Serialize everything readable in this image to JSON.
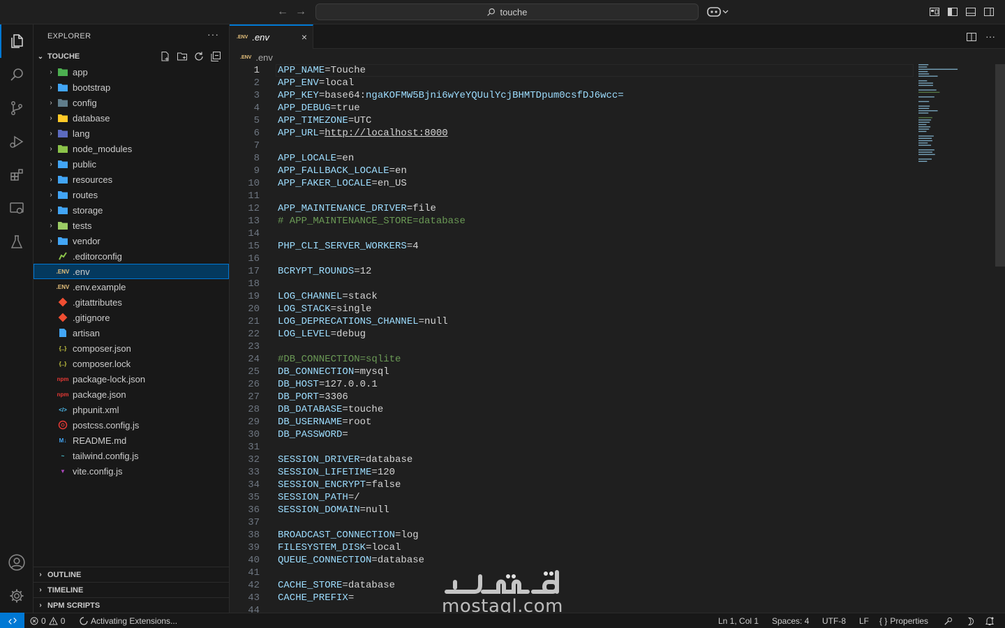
{
  "titlebar": {
    "search_text": "touche"
  },
  "sidebar": {
    "title": "EXPLORER",
    "more": "···",
    "folder_name": "TOUCHE",
    "items": [
      {
        "label": "app",
        "kind": "folder",
        "icon": "app-folder-icon",
        "color": "#4caf50"
      },
      {
        "label": "bootstrap",
        "kind": "folder",
        "icon": "folder-icon",
        "color": "#42a5f5"
      },
      {
        "label": "config",
        "kind": "folder",
        "icon": "config-folder-icon",
        "color": "#607d8b"
      },
      {
        "label": "database",
        "kind": "folder",
        "icon": "database-folder-icon",
        "color": "#ffca28"
      },
      {
        "label": "lang",
        "kind": "folder",
        "icon": "lang-folder-icon",
        "color": "#5c6bc0"
      },
      {
        "label": "node_modules",
        "kind": "folder",
        "icon": "node-folder-icon",
        "color": "#8bc34a"
      },
      {
        "label": "public",
        "kind": "folder",
        "icon": "folder-icon",
        "color": "#42a5f5"
      },
      {
        "label": "resources",
        "kind": "folder",
        "icon": "folder-icon",
        "color": "#42a5f5"
      },
      {
        "label": "routes",
        "kind": "folder",
        "icon": "folder-icon",
        "color": "#42a5f5"
      },
      {
        "label": "storage",
        "kind": "folder",
        "icon": "folder-icon",
        "color": "#42a5f5"
      },
      {
        "label": "tests",
        "kind": "folder",
        "icon": "tests-folder-icon",
        "color": "#9ccc65"
      },
      {
        "label": "vendor",
        "kind": "folder",
        "icon": "folder-icon",
        "color": "#42a5f5"
      },
      {
        "label": ".editorconfig",
        "kind": "file",
        "icon": "editorconfig-icon",
        "color": "#8bc34a"
      },
      {
        "label": ".env",
        "kind": "file",
        "icon": "env-file-icon",
        "color": "#e5c07b",
        "badge": ".ENV"
      },
      {
        "label": ".env.example",
        "kind": "file",
        "icon": "env-file-icon",
        "color": "#e5c07b",
        "badge": ".ENV"
      },
      {
        "label": ".gitattributes",
        "kind": "file",
        "icon": "git-icon",
        "color": "#f14e32"
      },
      {
        "label": ".gitignore",
        "kind": "file",
        "icon": "git-icon",
        "color": "#f14e32"
      },
      {
        "label": "artisan",
        "kind": "file",
        "icon": "file-icon",
        "color": "#42a5f5"
      },
      {
        "label": "composer.json",
        "kind": "file",
        "icon": "json-braces-icon",
        "color": "#cbcb41",
        "badge": "{..}"
      },
      {
        "label": "composer.lock",
        "kind": "file",
        "icon": "json-braces-icon",
        "color": "#cbcb41",
        "badge": "{..}"
      },
      {
        "label": "package-lock.json",
        "kind": "file",
        "icon": "npm-icon",
        "color": "#e53935",
        "badge": "npm"
      },
      {
        "label": "package.json",
        "kind": "file",
        "icon": "npm-icon",
        "color": "#e53935",
        "badge": "npm"
      },
      {
        "label": "phpunit.xml",
        "kind": "file",
        "icon": "xml-icon",
        "color": "#4fc3f7",
        "badge": "</>"
      },
      {
        "label": "postcss.config.js",
        "kind": "file",
        "icon": "postcss-icon",
        "color": "#e53935"
      },
      {
        "label": "README.md",
        "kind": "file",
        "icon": "markdown-icon",
        "color": "#42a5f5",
        "badge": "M↓"
      },
      {
        "label": "tailwind.config.js",
        "kind": "file",
        "icon": "tailwind-icon",
        "color": "#4dd0e1",
        "badge": "~"
      },
      {
        "label": "vite.config.js",
        "kind": "file",
        "icon": "vite-icon",
        "color": "#ab47bc",
        "badge": "▼"
      }
    ],
    "selected_index": 13,
    "bottom_sections": [
      "OUTLINE",
      "TIMELINE",
      "NPM SCRIPTS"
    ]
  },
  "editor": {
    "tab_label": ".env",
    "tab_badge": ".ENV",
    "tab_close": "×",
    "breadcrumb": ".env",
    "lines": [
      {
        "n": "1",
        "k": "APP_NAME",
        "v": "Touche"
      },
      {
        "n": "2",
        "k": "APP_ENV",
        "v": "local"
      },
      {
        "n": "3",
        "k": "APP_KEY",
        "v": "base64:",
        "v2": "ngaKOFMW5Bjni6wYeYQUulYcjBHMTDpum0csfDJ6wcc="
      },
      {
        "n": "4",
        "k": "APP_DEBUG",
        "v": "true"
      },
      {
        "n": "5",
        "k": "APP_TIMEZONE",
        "v": "UTC"
      },
      {
        "n": "6",
        "k": "APP_URL",
        "v": "http://localhost:8000",
        "url": true
      },
      {
        "n": "7"
      },
      {
        "n": "8",
        "k": "APP_LOCALE",
        "v": "en"
      },
      {
        "n": "9",
        "k": "APP_FALLBACK_LOCALE",
        "v": "en"
      },
      {
        "n": "10",
        "k": "APP_FAKER_LOCALE",
        "v": "en_US"
      },
      {
        "n": "11"
      },
      {
        "n": "12",
        "k": "APP_MAINTENANCE_DRIVER",
        "v": "file"
      },
      {
        "n": "13",
        "c": "# APP_MAINTENANCE_STORE=database"
      },
      {
        "n": "14"
      },
      {
        "n": "15",
        "k": "PHP_CLI_SERVER_WORKERS",
        "v": "4"
      },
      {
        "n": "16"
      },
      {
        "n": "17",
        "k": "BCRYPT_ROUNDS",
        "v": "12"
      },
      {
        "n": "18"
      },
      {
        "n": "19",
        "k": "LOG_CHANNEL",
        "v": "stack"
      },
      {
        "n": "20",
        "k": "LOG_STACK",
        "v": "single"
      },
      {
        "n": "21",
        "k": "LOG_DEPRECATIONS_CHANNEL",
        "v": "null"
      },
      {
        "n": "22",
        "k": "LOG_LEVEL",
        "v": "debug"
      },
      {
        "n": "23"
      },
      {
        "n": "24",
        "c": "#DB_CONNECTION=sqlite"
      },
      {
        "n": "25",
        "k": "DB_CONNECTION",
        "v": "mysql"
      },
      {
        "n": "26",
        "k": "DB_HOST",
        "v": "127.0.0.1"
      },
      {
        "n": "27",
        "k": "DB_PORT",
        "v": "3306"
      },
      {
        "n": "28",
        "k": "DB_DATABASE",
        "v": "touche"
      },
      {
        "n": "29",
        "k": "DB_USERNAME",
        "v": "root"
      },
      {
        "n": "30",
        "k": "DB_PASSWORD",
        "v": ""
      },
      {
        "n": "31"
      },
      {
        "n": "32",
        "k": "SESSION_DRIVER",
        "v": "database"
      },
      {
        "n": "33",
        "k": "SESSION_LIFETIME",
        "v": "120"
      },
      {
        "n": "34",
        "k": "SESSION_ENCRYPT",
        "v": "false"
      },
      {
        "n": "35",
        "k": "SESSION_PATH",
        "v": "/"
      },
      {
        "n": "36",
        "k": "SESSION_DOMAIN",
        "v": "null"
      },
      {
        "n": "37"
      },
      {
        "n": "38",
        "k": "BROADCAST_CONNECTION",
        "v": "log"
      },
      {
        "n": "39",
        "k": "FILESYSTEM_DISK",
        "v": "local"
      },
      {
        "n": "40",
        "k": "QUEUE_CONNECTION",
        "v": "database"
      },
      {
        "n": "41"
      },
      {
        "n": "42",
        "k": "CACHE_STORE",
        "v": "database"
      },
      {
        "n": "43",
        "k": "CACHE_PREFIX",
        "v": ""
      },
      {
        "n": "44"
      }
    ]
  },
  "statusbar": {
    "errors": "0",
    "warnings": "0",
    "activity": "Activating Extensions...",
    "position": "Ln 1, Col 1",
    "spaces": "Spaces: 4",
    "encoding": "UTF-8",
    "eol": "LF",
    "language": "Properties"
  },
  "watermark": {
    "logo_text": "مستقل",
    "site": "mostaql.com"
  },
  "colors": {
    "accent": "#0078d4",
    "key": "#9cdcfe",
    "comment": "#6a9955"
  }
}
